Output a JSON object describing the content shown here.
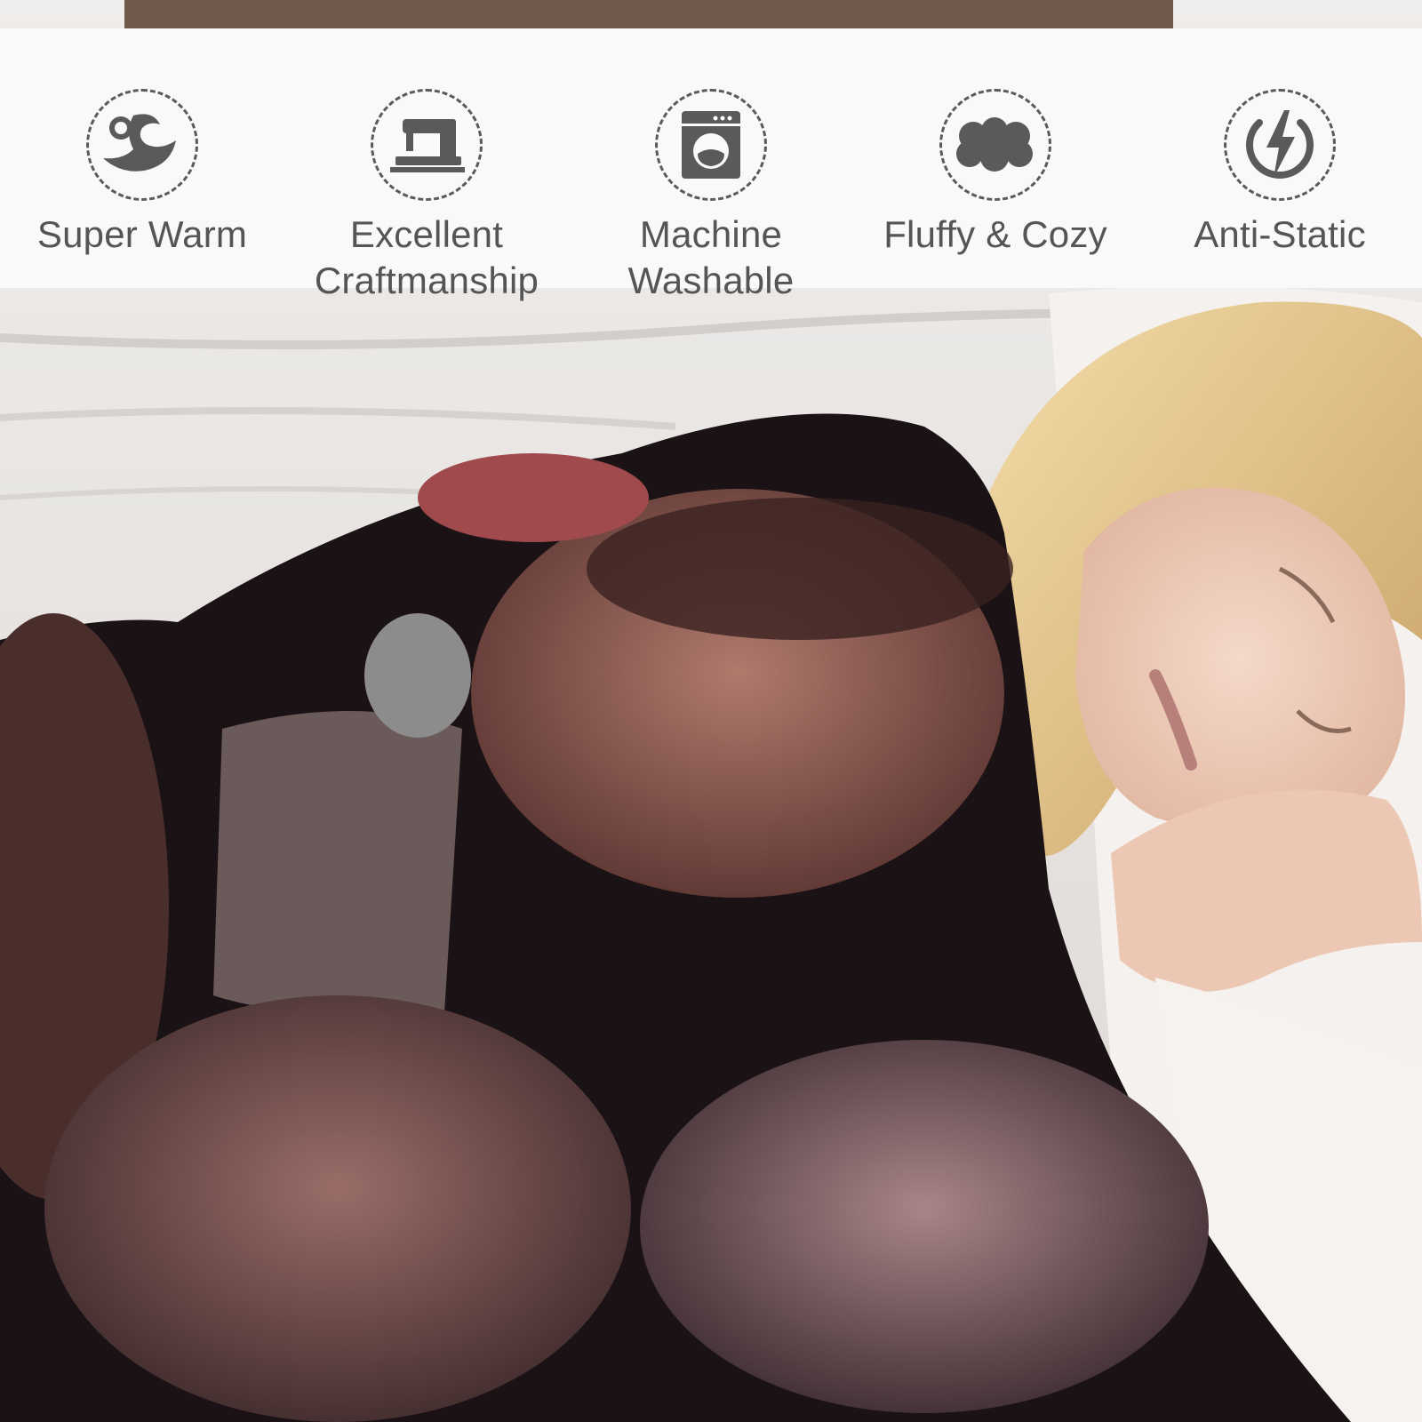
{
  "features": [
    {
      "label": "Super Warm",
      "icon": "wave-drop-icon"
    },
    {
      "label": "Excellent Craftmanship",
      "icon": "sewing-machine-icon"
    },
    {
      "label": "Machine Washable",
      "icon": "washing-machine-icon"
    },
    {
      "label": "Fluffy & Cozy",
      "icon": "cloud-icon"
    },
    {
      "label": "Anti-Static",
      "icon": "lightning-icon"
    }
  ],
  "colors": {
    "banner": "#fafafa",
    "icon": "#5a5a5a",
    "text": "#555555",
    "blanket": "#1a1214",
    "hair": "#e8c78a"
  }
}
